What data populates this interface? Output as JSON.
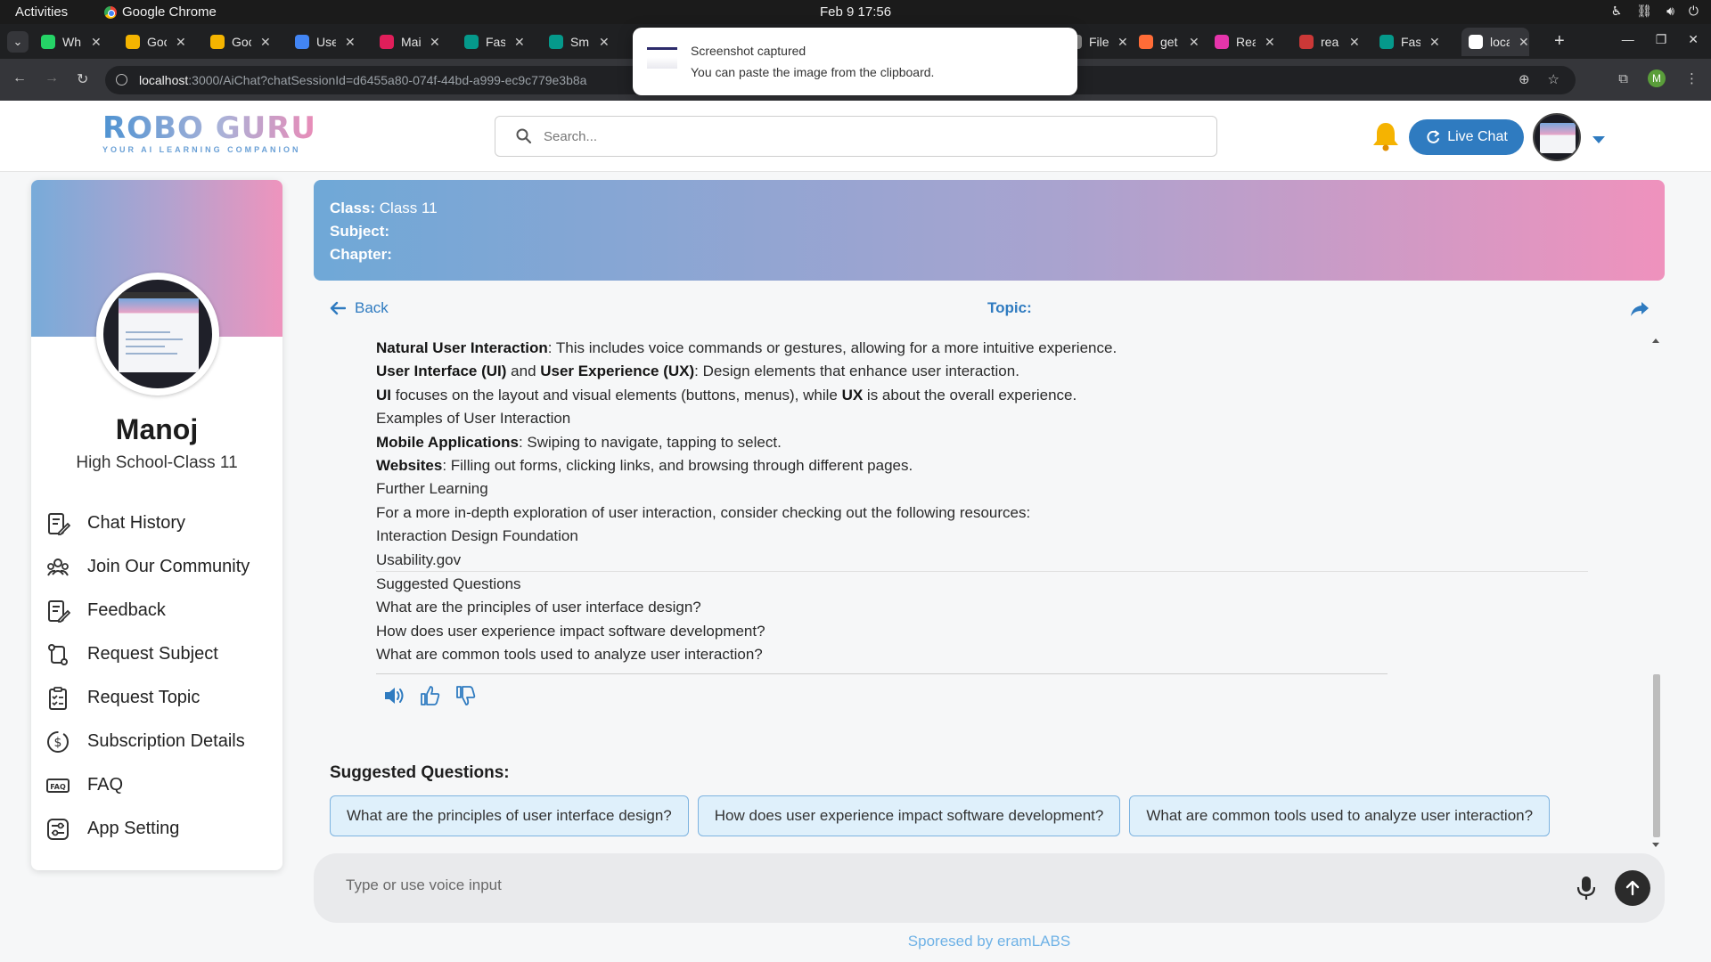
{
  "os": {
    "activities": "Activities",
    "app_name": "Google Chrome",
    "clock": "Feb 9  17:56"
  },
  "tabs": [
    {
      "label": "Wh",
      "color": "#25d366"
    },
    {
      "label": "Goc",
      "color": "#f4b400"
    },
    {
      "label": "Goc",
      "color": "#f4b400"
    },
    {
      "label": "Use",
      "color": "#4285f4"
    },
    {
      "label": "Mai",
      "color": "#e01e5a"
    },
    {
      "label": "Fas",
      "color": "#05998b"
    },
    {
      "label": "Sm",
      "color": "#05998b"
    },
    {
      "label": "File",
      "color": "#888888"
    },
    {
      "label": "get",
      "color": "#ff6c37"
    },
    {
      "label": "Rea",
      "color": "#e535ab"
    },
    {
      "label": "rea",
      "color": "#cb3837"
    },
    {
      "label": "Fas",
      "color": "#05998b"
    },
    {
      "label": "loca",
      "color": "#ffffff"
    }
  ],
  "address": {
    "host": "localhost",
    "path": ":3000/AiChat?chatSessionId=d6455a80-074f-44bd-a999-ec9c779e3b8a",
    "profile_initial": "M"
  },
  "toast": {
    "title": "Screenshot captured",
    "subtitle": "You can paste the image from the clipboard."
  },
  "header": {
    "logo": "ROBO GURU",
    "tagline": "YOUR AI LEARNING COMPANION",
    "search_placeholder": "Search...",
    "live_chat": "Live Chat"
  },
  "sidebar": {
    "name": "Manoj",
    "class": "High School-Class 11",
    "items": [
      {
        "label": "Chat History",
        "icon": "edit-note-icon"
      },
      {
        "label": "Join Our Community",
        "icon": "community-icon"
      },
      {
        "label": "Feedback",
        "icon": "feedback-icon"
      },
      {
        "label": "Request Subject",
        "icon": "request-subject-icon"
      },
      {
        "label": "Request Topic",
        "icon": "clipboard-check-icon"
      },
      {
        "label": "Subscription Details",
        "icon": "dollar-icon"
      },
      {
        "label": "FAQ",
        "icon": "faq-icon"
      },
      {
        "label": "App Setting",
        "icon": "settings-icon"
      }
    ]
  },
  "banner": {
    "class_label": "Class:",
    "class_value": "Class 11",
    "subject_label": "Subject:",
    "subject_value": "",
    "chapter_label": "Chapter:",
    "chapter_value": ""
  },
  "chat": {
    "back": "Back",
    "topic_label": "Topic:",
    "lines": [
      {
        "b1": "Natural User Interaction",
        "t1": ": This includes voice commands or gestures, allowing for a more intuitive experience.",
        "b2": "",
        "t2": ""
      },
      {
        "b1": "User Interface (UI)",
        "t1": " and ",
        "b2": "User Experience (UX)",
        "t2": ": Design elements that enhance user interaction."
      },
      {
        "b1": "UI",
        "t1": " focuses on the layout and visual elements (buttons, menus), while ",
        "b2": "UX",
        "t2": " is about the overall experience."
      },
      {
        "b1": "",
        "t1": "Examples of User Interaction",
        "b2": "",
        "t2": ""
      },
      {
        "b1": "Mobile Applications",
        "t1": ": Swiping to navigate, tapping to select.",
        "b2": "",
        "t2": ""
      },
      {
        "b1": "Websites",
        "t1": ": Filling out forms, clicking links, and browsing through different pages.",
        "b2": "",
        "t2": ""
      },
      {
        "b1": "",
        "t1": "Further Learning",
        "b2": "",
        "t2": ""
      },
      {
        "b1": "",
        "t1": "For a more in-depth exploration of user interaction, consider checking out the following resources:",
        "b2": "",
        "t2": ""
      },
      {
        "b1": "",
        "t1": "Interaction Design Foundation",
        "b2": "",
        "t2": ""
      },
      {
        "b1": "",
        "t1": "Usability.gov",
        "b2": "",
        "t2": ""
      },
      {
        "b1": "",
        "t1": "Suggested Questions",
        "b2": "",
        "t2": ""
      },
      {
        "b1": "",
        "t1": "What are the principles of user interface design?",
        "b2": "",
        "t2": ""
      },
      {
        "b1": "",
        "t1": "How does user experience impact software development?",
        "b2": "",
        "t2": ""
      },
      {
        "b1": "",
        "t1": "What are common tools used to analyze user interaction?",
        "b2": "",
        "t2": ""
      }
    ],
    "suggested_title": "Suggested Questions:",
    "suggestions": [
      "What are the principles of user interface design?",
      "How does user experience impact software development?",
      "What are common tools used to analyze user interaction?"
    ],
    "input_placeholder": "Type or use voice input"
  },
  "footer": "Sporesed by eramLABS",
  "colors": {
    "brand_blue": "#2f7bc0",
    "gradient_start": "#6fa8d7",
    "gradient_end": "#ef92bd"
  }
}
